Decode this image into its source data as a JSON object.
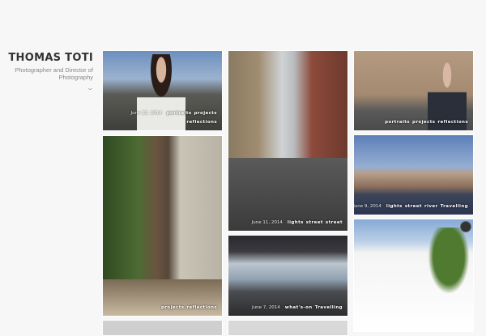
{
  "header": {
    "title": "THOMAS TOTI",
    "subtitle": "Photographer and Director of Photography"
  },
  "tiles": [
    {
      "date": "June 13, 2014",
      "tags": [
        "portraits",
        "projects"
      ],
      "tags2": [
        "reflections"
      ]
    },
    {
      "date": "June 11, 2014",
      "tags": [
        "lights",
        "street",
        "street"
      ]
    },
    {
      "tags": [
        "portraits",
        "projects",
        "reflections"
      ]
    },
    {
      "date": "June 9, 2014",
      "tags": [
        "lights",
        "street",
        "river",
        "Travelling"
      ]
    },
    {
      "tags": [
        "projects",
        "reflections"
      ]
    },
    {
      "date": "June 7, 2014",
      "tags": [
        "what's-on",
        "Travelling"
      ]
    }
  ]
}
